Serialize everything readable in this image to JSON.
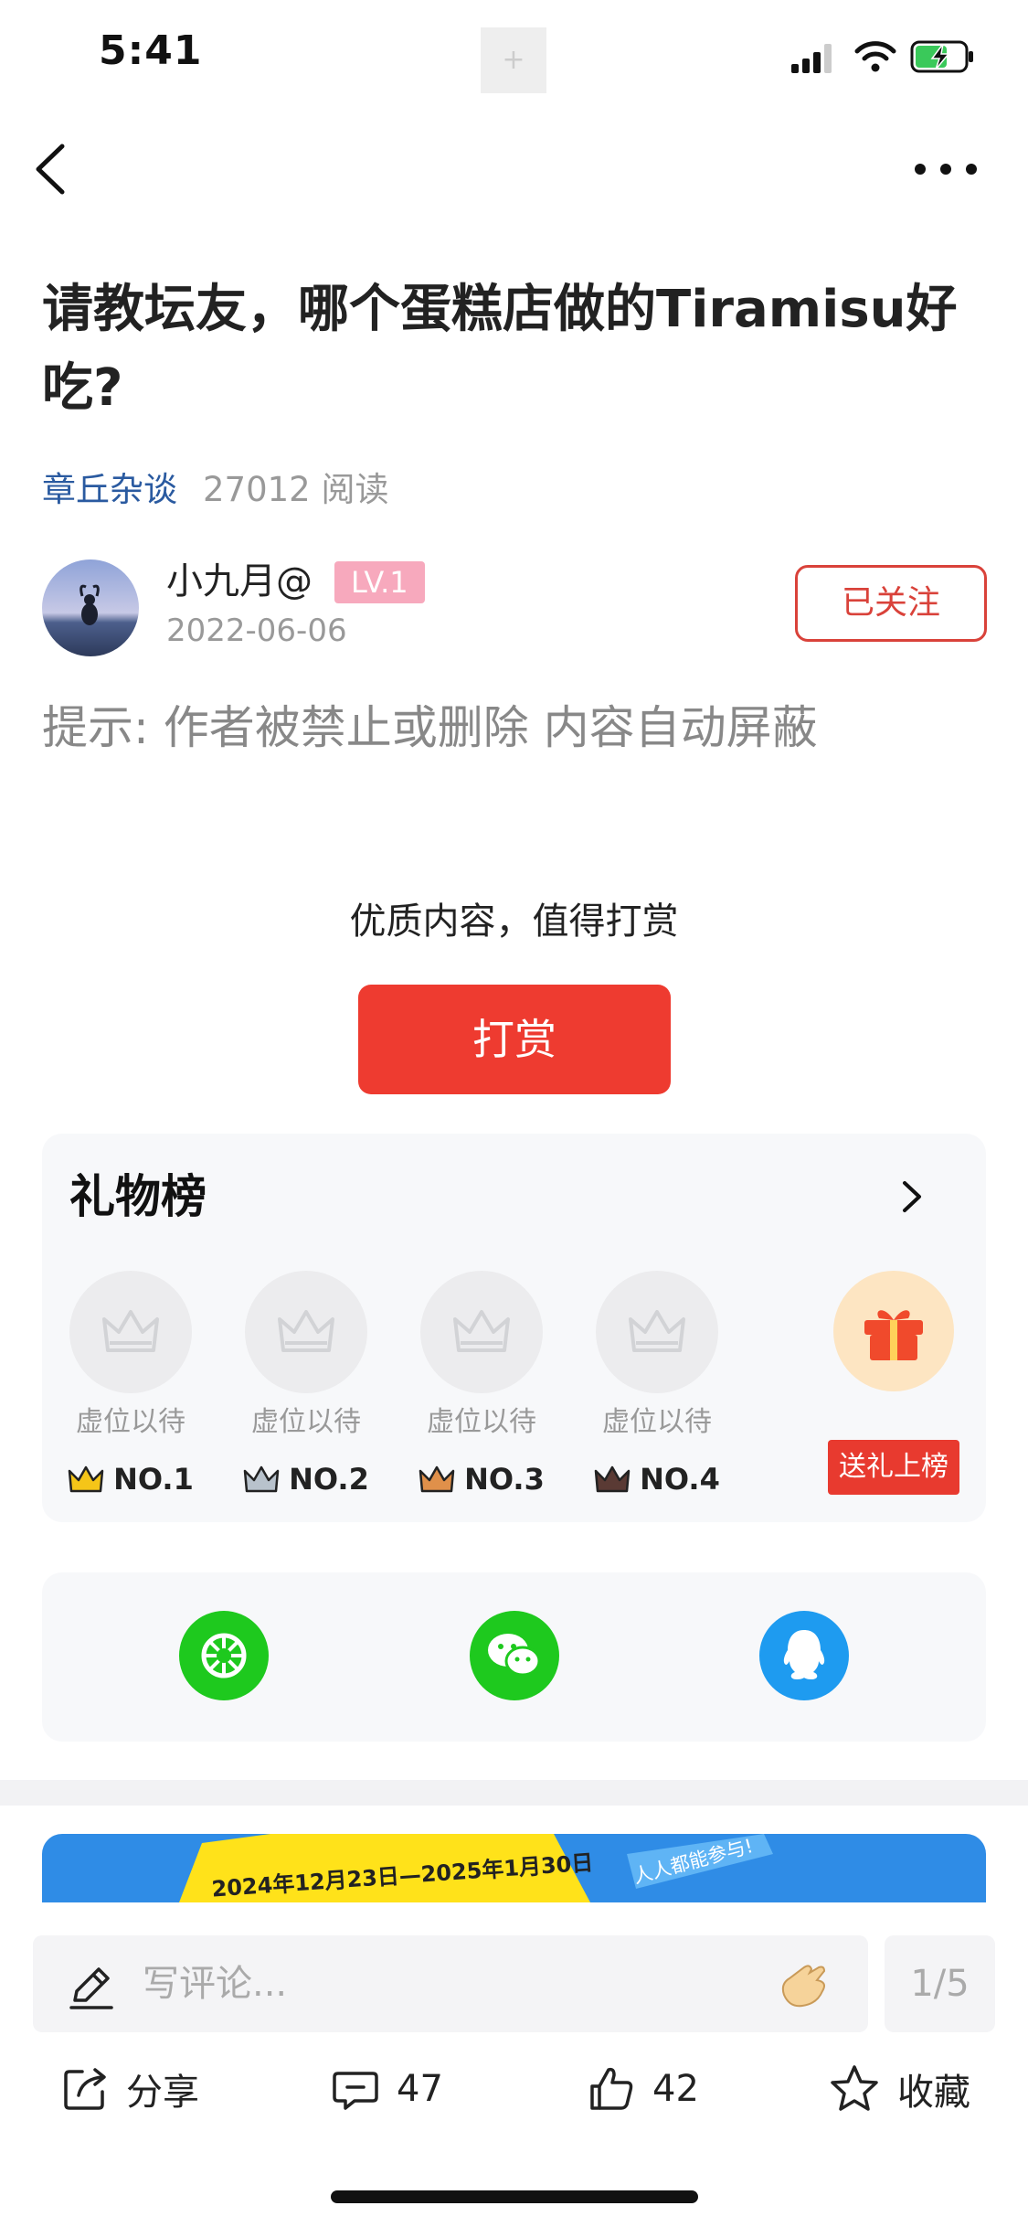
{
  "status_bar": {
    "time": "5:41",
    "center_box": "+"
  },
  "post": {
    "title": "请教坛友，哪个蛋糕店做的Tiramisu好吃?",
    "forum": "章丘杂谈",
    "read_count": "27012 阅读",
    "author": {
      "name": "小九月@",
      "level": "LV.1",
      "date": "2022-06-06",
      "follow_label": "已关注"
    },
    "hint": "提示: 作者被禁止或删除 内容自动屏蔽"
  },
  "reward": {
    "text": "优质内容，值得打赏",
    "button_label": "打赏"
  },
  "gift_board": {
    "title": "礼物榜",
    "slots": [
      {
        "label": "虚位以待",
        "rank": "NO.1",
        "crown_color": "#f5c518"
      },
      {
        "label": "虚位以待",
        "rank": "NO.2",
        "crown_color": "#b8c2cc"
      },
      {
        "label": "虚位以待",
        "rank": "NO.3",
        "crown_color": "#e0904a"
      },
      {
        "label": "虚位以待",
        "rank": "NO.4",
        "crown_color": "#5a3a34"
      }
    ],
    "send_gift_label": "送礼上榜"
  },
  "share": {
    "targets": [
      {
        "name": "moments",
        "icon": "moments-icon",
        "color": "#1ec91e"
      },
      {
        "name": "wechat",
        "icon": "wechat-icon",
        "color": "#1ec91e"
      },
      {
        "name": "qq",
        "icon": "qq-icon",
        "color": "#1e9bf0"
      }
    ]
  },
  "banner": {
    "date_text": "2024年12月23日—2025年1月30日",
    "tag_text": "人人都能参与!"
  },
  "bottom_bar": {
    "comment_placeholder": "写评论...",
    "page_indicator": "1/5",
    "share_label": "分享",
    "comment_count": "47",
    "like_count": "42",
    "favorite_label": "收藏"
  }
}
